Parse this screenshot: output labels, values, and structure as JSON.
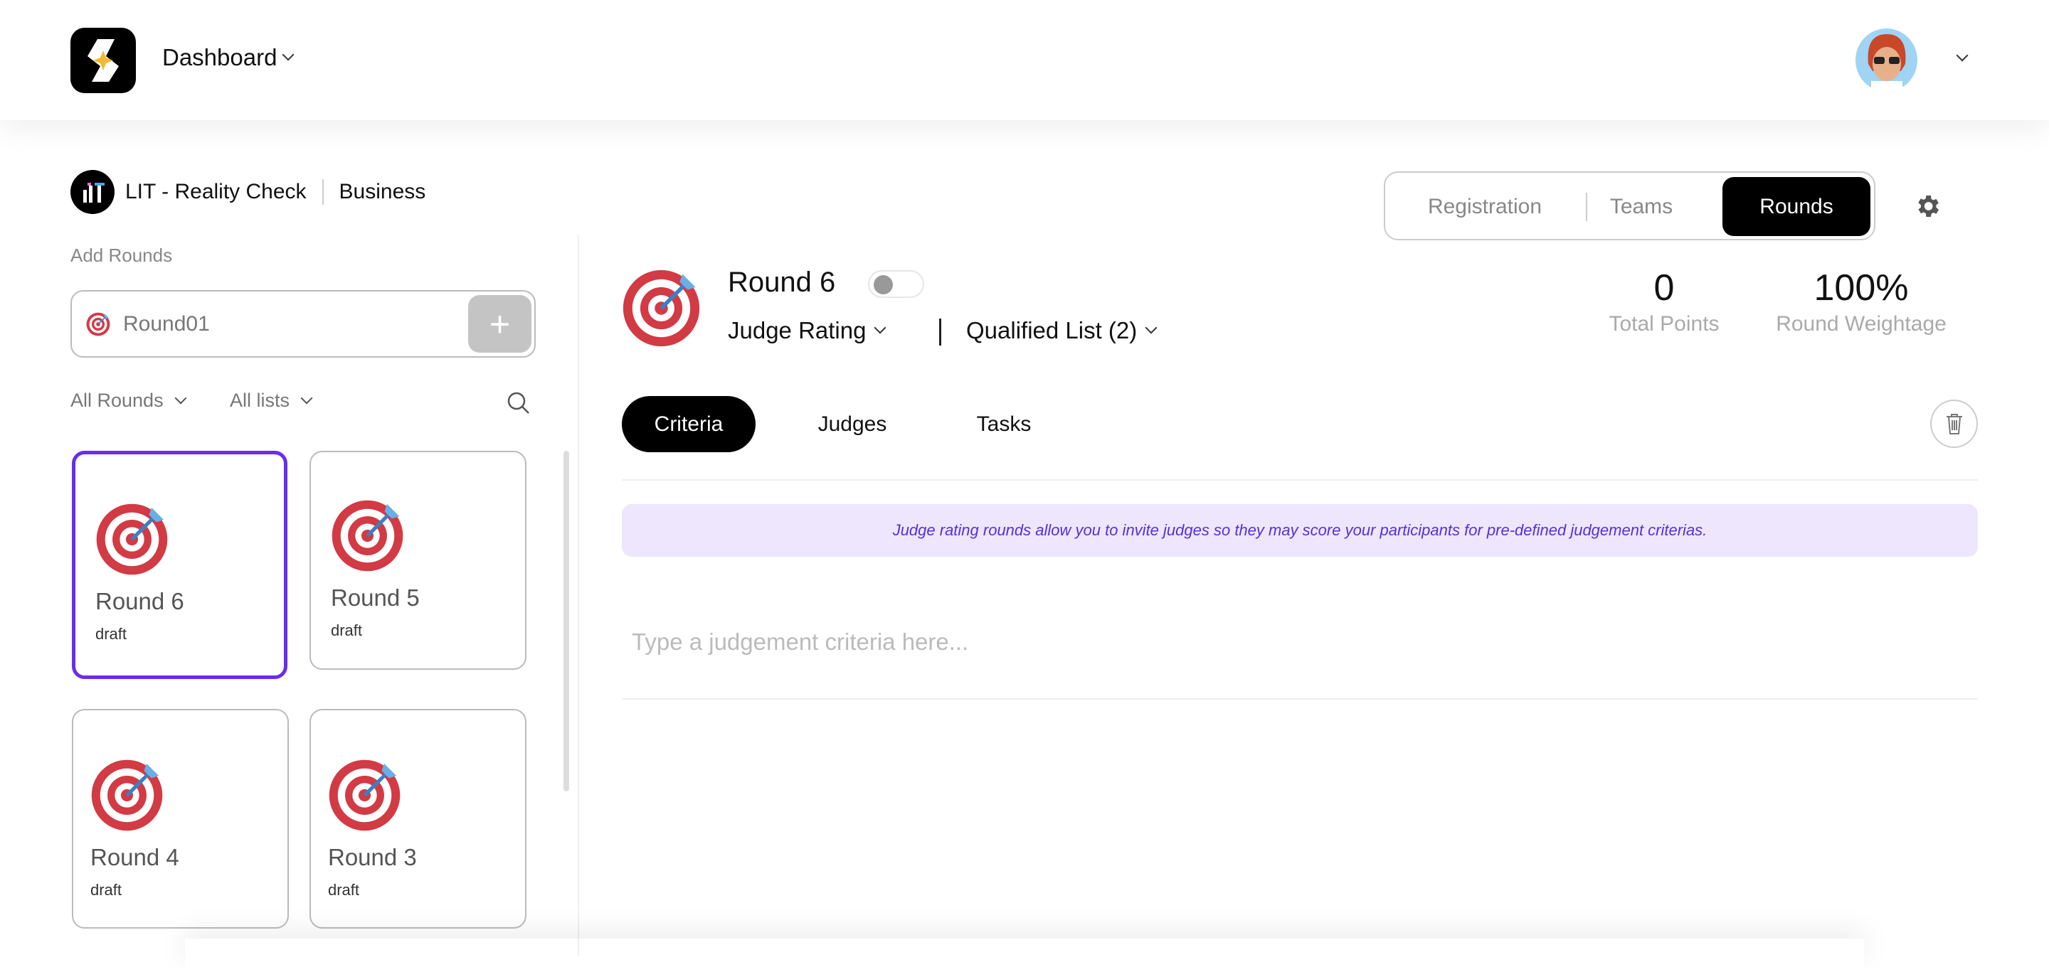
{
  "header": {
    "app_title": "Dashboard"
  },
  "org": {
    "name": "LIT - Reality Check",
    "type": "Business"
  },
  "sidebar": {
    "add_label": "Add Rounds",
    "input_value": "Round01",
    "add_button": "+",
    "filter_rounds": "All Rounds",
    "filter_lists": "All lists",
    "cards": [
      {
        "title": "Round 6",
        "status": "draft",
        "selected": true
      },
      {
        "title": "Round 5",
        "status": "draft"
      },
      {
        "title": "Round 4",
        "status": "draft"
      },
      {
        "title": "Round 3",
        "status": "draft"
      }
    ]
  },
  "nav": {
    "tabs": [
      "Registration",
      "Teams",
      "Rounds"
    ],
    "active": "Rounds"
  },
  "round": {
    "title": "Round 6",
    "type": "Judge Rating",
    "qualified": "Qualified List (2)",
    "total_points": "0",
    "total_points_label": "Total Points",
    "weightage": "100%",
    "weightage_label": "Round Weightage",
    "tabs": [
      "Criteria",
      "Judges",
      "Tasks"
    ],
    "info": "Judge rating rounds allow you to invite judges so they may score your participants for pre-defined judgement criterias.",
    "criteria_placeholder": "Type a judgement criteria here..."
  },
  "colors": {
    "accent": "#6a2cf0",
    "info_bg": "#ede6fd"
  }
}
